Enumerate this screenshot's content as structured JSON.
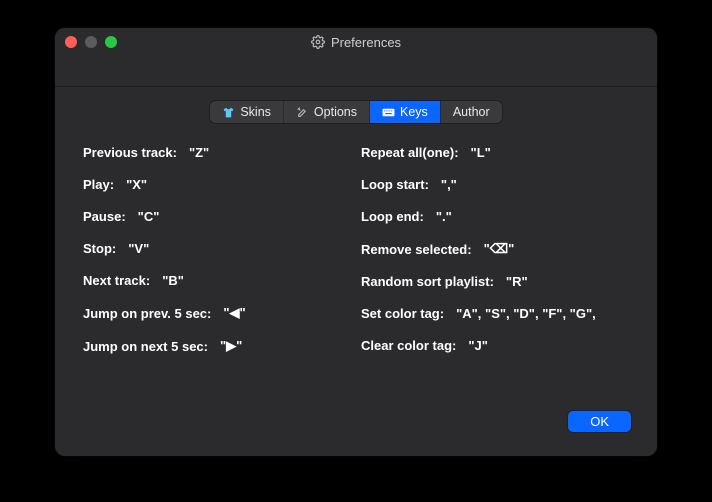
{
  "window": {
    "title": "Preferences"
  },
  "tabs": {
    "skins": "Skins",
    "options": "Options",
    "keys": "Keys",
    "author": "Author"
  },
  "keys_left": [
    {
      "label": "Previous track",
      "value": "\"Z\""
    },
    {
      "label": "Play",
      "value": "\"X\""
    },
    {
      "label": "Pause",
      "value": "\"C\""
    },
    {
      "label": "Stop",
      "value": "\"V\""
    },
    {
      "label": "Next track",
      "value": "\"B\""
    },
    {
      "label": "Jump on prev. 5 sec",
      "value": "\"◀\""
    },
    {
      "label": "Jump on next 5 sec",
      "value": "\"▶\""
    }
  ],
  "keys_right": [
    {
      "label": "Repeat all(one)",
      "value": "\"L\""
    },
    {
      "label": "Loop start",
      "value": "\",\""
    },
    {
      "label": "Loop end",
      "value": "\".\""
    },
    {
      "label": "Remove selected",
      "value": "\"⌫\""
    },
    {
      "label": "Random sort playlist",
      "value": "\"R\""
    },
    {
      "label": "Set color tag",
      "value": "\"A\", \"S\", \"D\", \"F\", \"G\","
    },
    {
      "label": "Clear color tag",
      "value": "\"J\""
    }
  ],
  "buttons": {
    "ok": "OK"
  }
}
